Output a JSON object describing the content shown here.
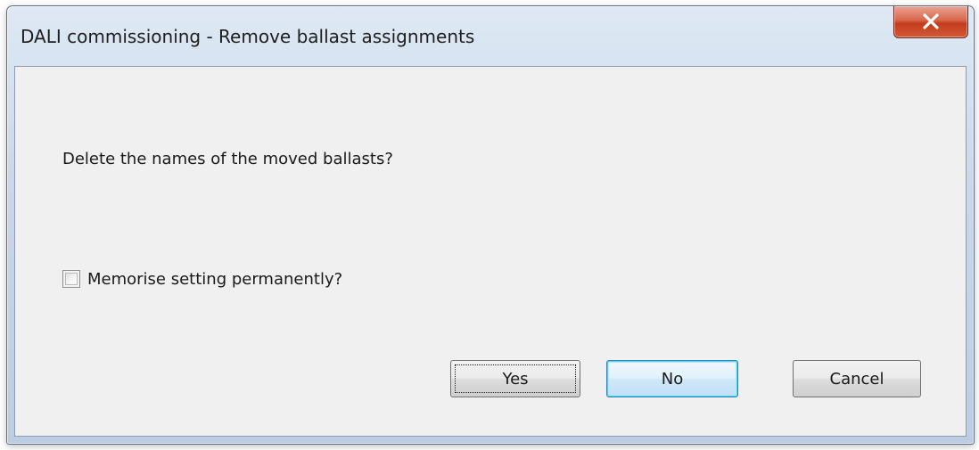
{
  "window": {
    "title": "DALI commissioning - Remove ballast assignments",
    "close_icon": "close-icon"
  },
  "dialog": {
    "question": "Delete the names of the moved ballasts?",
    "checkbox": {
      "label": "Memorise setting permanently?",
      "checked": false
    },
    "buttons": {
      "yes": "Yes",
      "no": "No",
      "cancel": "Cancel"
    }
  },
  "colors": {
    "close_button": "#c43b1c",
    "default_button_border": "#3c7fb1",
    "client_background": "#f0f0f0"
  }
}
